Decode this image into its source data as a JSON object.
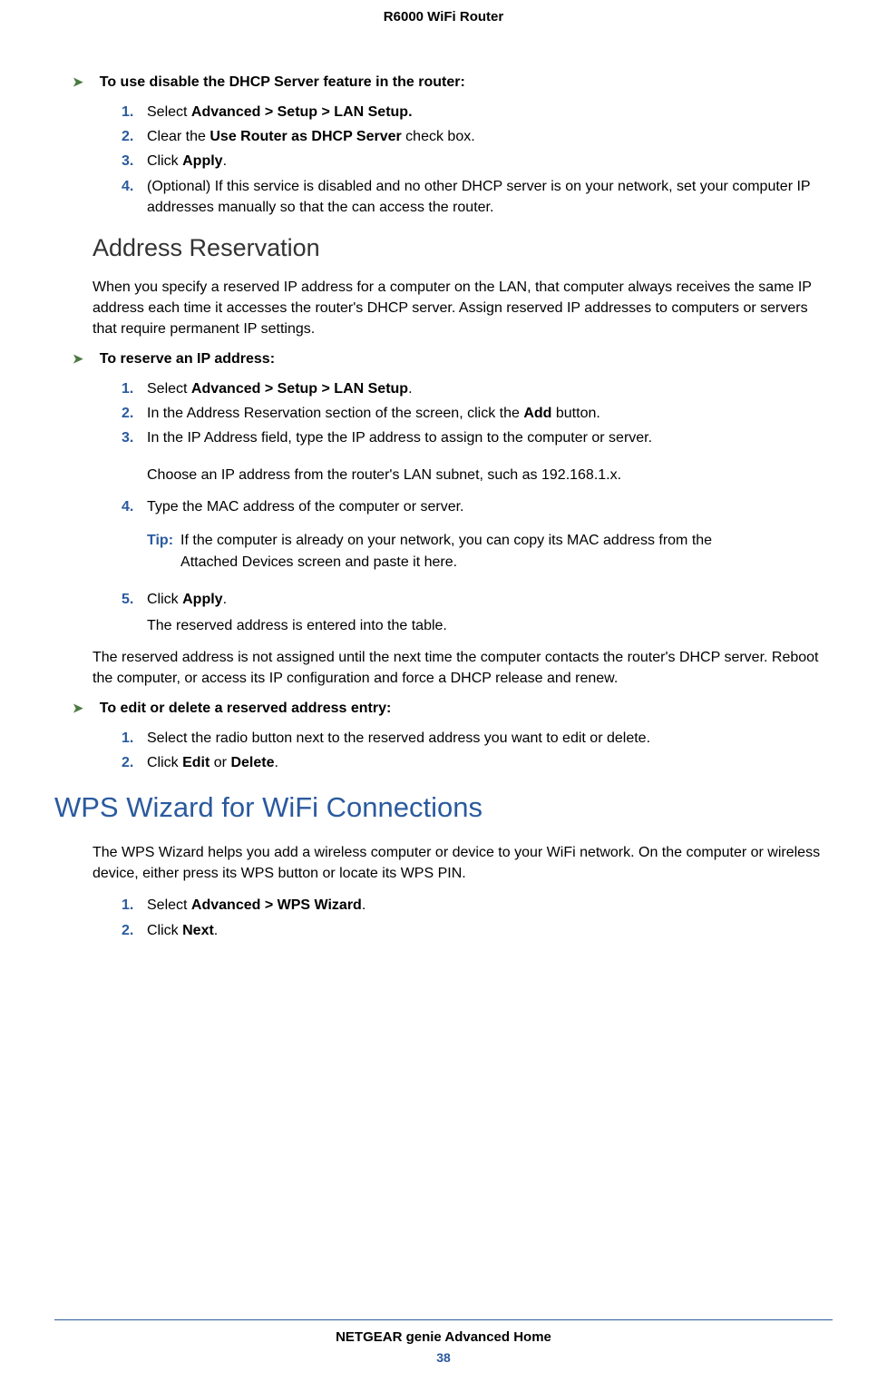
{
  "header": {
    "title": "R6000 WiFi Router"
  },
  "sections": {
    "dhcp_disable": {
      "heading": "To use disable the DHCP Server feature in the router:",
      "steps": {
        "s1_pre": "Select ",
        "s1_bold": "Advanced > Setup > LAN Setup.",
        "s2_pre": "Clear the ",
        "s2_bold": "Use Router as DHCP Server",
        "s2_post": " check box.",
        "s3_pre": "Click ",
        "s3_bold": "Apply",
        "s3_post": ".",
        "s4": "(Optional) If this service is disabled and no other DHCP server is on your network, set your computer IP addresses manually so that the can access the router."
      }
    },
    "address_reservation": {
      "title": "Address Reservation",
      "intro": "When you specify a reserved IP address for a computer on the LAN, that computer always receives the same IP address each time it accesses the router's DHCP server. Assign reserved IP addresses to computers or servers that require permanent IP settings.",
      "heading": "To reserve an IP address:",
      "steps": {
        "s1_pre": "Select ",
        "s1_bold": "Advanced > Setup > LAN Setup",
        "s1_post": ".",
        "s2_pre": "In the Address Reservation section of the screen, click the ",
        "s2_bold": "Add",
        "s2_post": " button.",
        "s3": "In the IP Address field, type the IP address to assign to the computer or server.",
        "s3_sub": "Choose an IP address from the router's LAN subnet, such as 192.168.1.x.",
        "s4": "Type the MAC address of the computer or server.",
        "tip_label": "Tip:",
        "tip_text": "If the computer is already on your network, you can copy its MAC address from the Attached Devices screen and paste it here.",
        "s5_pre": "Click ",
        "s5_bold": "Apply",
        "s5_post": ".",
        "s5_sub": "The reserved address is entered into the table."
      },
      "outro": "The reserved address is not assigned until the next time the computer contacts the router's DHCP server. Reboot the computer, or access its IP configuration and force a DHCP release and renew."
    },
    "edit_delete": {
      "heading": "To edit or delete a reserved address entry:",
      "steps": {
        "s1": "Select the radio button next to the reserved address you want to edit or delete.",
        "s2_pre": "Click ",
        "s2_bold1": "Edit",
        "s2_mid": " or ",
        "s2_bold2": "Delete",
        "s2_post": "."
      }
    },
    "wps": {
      "title": "WPS Wizard for WiFi Connections",
      "intro": "The WPS Wizard helps you add a wireless computer or device to your WiFi network. On the computer or wireless device, either press its WPS button or locate its WPS PIN.",
      "steps": {
        "s1_pre": "Select ",
        "s1_bold": "Advanced > WPS Wizard",
        "s1_post": ".",
        "s2_pre": "Click ",
        "s2_bold": "Next",
        "s2_post": "."
      }
    }
  },
  "footer": {
    "text": "NETGEAR genie Advanced Home",
    "page": "38"
  },
  "numbers": {
    "n1": "1.",
    "n2": "2.",
    "n3": "3.",
    "n4": "4.",
    "n5": "5."
  },
  "arrow": "➤"
}
